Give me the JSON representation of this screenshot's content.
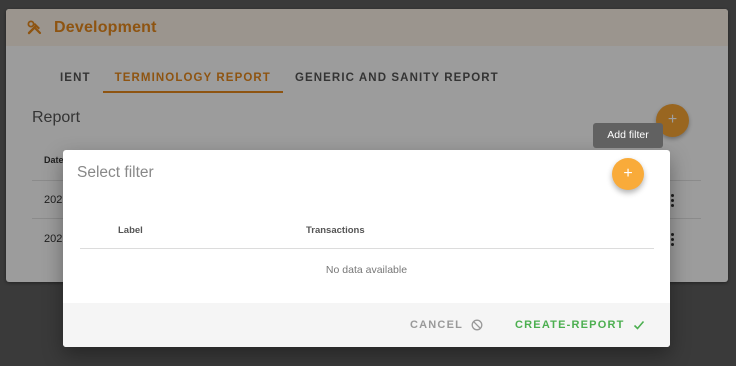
{
  "card": {
    "title": "Development"
  },
  "tabs": [
    {
      "label": "IENT"
    },
    {
      "label": "TERMINOLOGY REPORT"
    },
    {
      "label": "GENERIC AND SANITY REPORT"
    }
  ],
  "report": {
    "title": "Report",
    "add_button_label": "+",
    "table": {
      "columns": [
        "Date"
      ],
      "rows": [
        {
          "date": "202"
        },
        {
          "date": "202"
        }
      ]
    }
  },
  "tooltip": {
    "text": "Add filter"
  },
  "dialog": {
    "title": "Select filter",
    "add_button_label": "+",
    "table": {
      "columns": [
        "Label",
        "Transactions"
      ],
      "empty_text": "No data available"
    },
    "footer": {
      "cancel_label": "CANCEL",
      "create_label": "CREATE-REPORT"
    }
  },
  "colors": {
    "accent": "#e6881c",
    "fab": "#f9ab3a",
    "success": "#4caf50",
    "overlay": "rgba(0,0,0,0.38)"
  },
  "icons": {
    "header": "tools-icon",
    "cancel": "block-icon",
    "create": "check-icon",
    "row_menu": "more-vert-icon"
  }
}
